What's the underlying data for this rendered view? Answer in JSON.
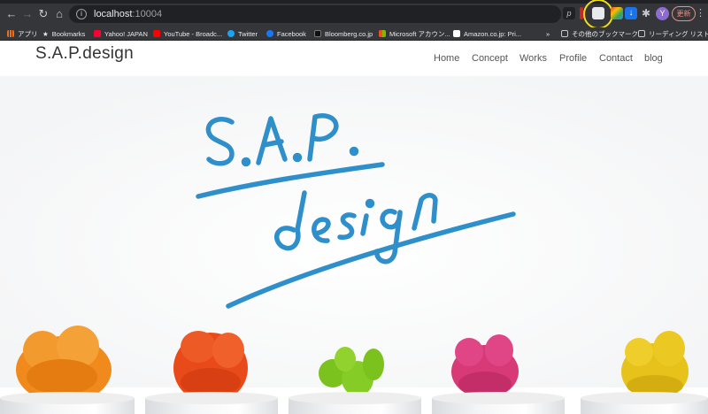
{
  "browser": {
    "url_host": "localhost",
    "url_port": ":10004",
    "update_label": "更新",
    "avatar_initial": "Y"
  },
  "bookmarks": [
    {
      "label": "アプリ",
      "icon": "apps-grid-icon",
      "color": "#e8711a"
    },
    {
      "label": "Bookmarks",
      "icon": "star-icon",
      "color": "#e8eaed"
    },
    {
      "label": "Yahoo! JAPAN",
      "icon": "yahoo-icon",
      "color": "#ff0033"
    },
    {
      "label": "YouTube - Broadc...",
      "icon": "youtube-icon",
      "color": "#ff0000"
    },
    {
      "label": "Twitter",
      "icon": "twitter-icon",
      "color": "#1da1f2"
    },
    {
      "label": "Facebook",
      "icon": "facebook-icon",
      "color": "#1877f2"
    },
    {
      "label": "Bloomberg.co.jp",
      "icon": "bloomberg-icon",
      "color": "#111111"
    },
    {
      "label": "Microsoft アカウン...",
      "icon": "microsoft-icon",
      "color": "#f25022"
    },
    {
      "label": "Amazon.co.jp: Pri...",
      "icon": "amazon-icon",
      "color": "#ffffff"
    },
    {
      "label": "»",
      "icon": "overflow-chevron-icon",
      "color": "#e8eaed"
    },
    {
      "label": "その他のブックマーク",
      "icon": "folder-icon",
      "color": "#e8eaed"
    },
    {
      "label": "リーディング リスト",
      "icon": "reading-list-icon",
      "color": "#e8eaed"
    }
  ],
  "site": {
    "logo": "S.A.P.design",
    "nav": [
      "Home",
      "Concept",
      "Works",
      "Profile",
      "Contact",
      "blog"
    ]
  },
  "hero": {
    "line1": "S.A.P.",
    "line2": "design",
    "brand_color": "#2f8fcb"
  },
  "cacti": [
    {
      "name": "orange",
      "color": "#f08a1c"
    },
    {
      "name": "red",
      "color": "#e84a1a"
    },
    {
      "name": "green",
      "color": "#7cc21e"
    },
    {
      "name": "pink",
      "color": "#d83a78"
    },
    {
      "name": "yellow",
      "color": "#e6c21a"
    }
  ]
}
